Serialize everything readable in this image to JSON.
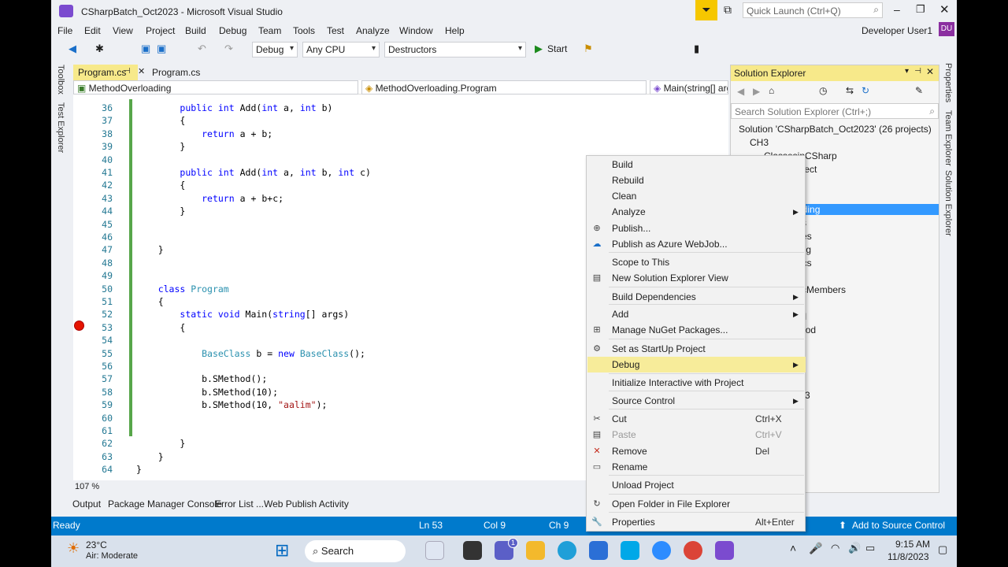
{
  "window": {
    "title": "CSharpBatch_Oct2023 - Microsoft Visual Studio",
    "quick_launch": "Quick Launch (Ctrl+Q)",
    "user": "Developer User1",
    "avatar": "DU"
  },
  "menu": [
    "File",
    "Edit",
    "View",
    "Project",
    "Build",
    "Debug",
    "Team",
    "Tools",
    "Test",
    "Analyze",
    "Window",
    "Help"
  ],
  "toolbar": {
    "config": "Debug",
    "platform": "Any CPU",
    "project": "Destructors",
    "start": "Start"
  },
  "sidebar_left": [
    "Toolbox",
    "Test Explorer"
  ],
  "tabs": [
    "Program.cs",
    "Program.cs"
  ],
  "nav": {
    "left": "MethodOverloading",
    "middle": "MethodOverloading.Program",
    "right": "Main(string[] args)"
  },
  "code": [
    {
      "n": "36",
      "t": "        public int Add(int a, int b)"
    },
    {
      "n": "37",
      "t": "        {"
    },
    {
      "n": "38",
      "t": "            return a + b;"
    },
    {
      "n": "39",
      "t": "        }"
    },
    {
      "n": "40",
      "t": ""
    },
    {
      "n": "41",
      "t": "        public int Add(int a, int b, int c)"
    },
    {
      "n": "42",
      "t": "        {"
    },
    {
      "n": "43",
      "t": "            return a + b+c;"
    },
    {
      "n": "44",
      "t": "        }"
    },
    {
      "n": "45",
      "t": ""
    },
    {
      "n": "46",
      "t": ""
    },
    {
      "n": "47",
      "t": "    }"
    },
    {
      "n": "48",
      "t": ""
    },
    {
      "n": "49",
      "t": ""
    },
    {
      "n": "50",
      "t": "    class Program"
    },
    {
      "n": "51",
      "t": "    {"
    },
    {
      "n": "52",
      "t": "        static void Main(string[] args)"
    },
    {
      "n": "53",
      "t": "        {"
    },
    {
      "n": "54",
      "t": ""
    },
    {
      "n": "55",
      "t": "            BaseClass b = new BaseClass();"
    },
    {
      "n": "56",
      "t": ""
    },
    {
      "n": "57",
      "t": "            b.SMethod();"
    },
    {
      "n": "58",
      "t": "            b.SMethod(10);"
    },
    {
      "n": "59",
      "t": "            b.SMethod(10, \"aalim\");"
    },
    {
      "n": "60",
      "t": ""
    },
    {
      "n": "61",
      "t": ""
    },
    {
      "n": "62",
      "t": "        }"
    },
    {
      "n": "63",
      "t": "    }"
    },
    {
      "n": "64",
      "t": "}"
    }
  ],
  "zoom": "107 %",
  "bottom_tabs": [
    "Output",
    "Package Manager Console",
    "Error List ...",
    "Web Publish Activity"
  ],
  "status": {
    "ready": "Ready",
    "ln": "Ln 53",
    "col": "Col 9",
    "ch": "Ch 9",
    "source_control": "Add to Source Control"
  },
  "solution_explorer": {
    "title": "Solution Explorer",
    "search": "Search Solution Explorer (Ctrl+;)",
    "items": [
      "Solution 'CSharpBatch_Oct2023' (26 projects)",
      "CH3",
      "ClassesinCSharp",
      "thMultObject",
      "uctorss",
      "uctors",
      "dOverloading",
      "perties",
      "erences",
      "p.config",
      "gram.cs",
      "ds",
      "AndPublicMembers",
      "ies",
      "iesControl",
      "TypeMethod",
      "asses",
      "ethod",
      "ariables",
      "h_Oct2023"
    ]
  },
  "sidebar_right": [
    "Properties",
    "Team Explorer",
    "Solution Explorer"
  ],
  "context_menu": [
    {
      "label": "Build"
    },
    {
      "label": "Rebuild"
    },
    {
      "label": "Clean"
    },
    {
      "label": "Analyze",
      "sub": true
    },
    {
      "label": "Publish..."
    },
    {
      "label": "Publish as Azure WebJob..."
    },
    {
      "label": "Scope to This"
    },
    {
      "label": "New Solution Explorer View"
    },
    {
      "label": "Build Dependencies",
      "sub": true
    },
    {
      "label": "Add",
      "sub": true
    },
    {
      "label": "Manage NuGet Packages..."
    },
    {
      "label": "Set as StartUp Project"
    },
    {
      "label": "Debug",
      "sub": true
    },
    {
      "label": "Initialize Interactive with Project"
    },
    {
      "label": "Source Control",
      "sub": true
    },
    {
      "label": "Cut",
      "sc": "Ctrl+X"
    },
    {
      "label": "Paste",
      "sc": "Ctrl+V"
    },
    {
      "label": "Remove",
      "sc": "Del"
    },
    {
      "label": "Rename"
    },
    {
      "label": "Unload Project"
    },
    {
      "label": "Open Folder in File Explorer"
    },
    {
      "label": "Properties",
      "sc": "Alt+Enter"
    }
  ],
  "taskbar": {
    "temp": "23°C",
    "weather": "Air: Moderate",
    "search": "Search",
    "time": "9:15 AM",
    "date": "11/8/2023",
    "badge": "1"
  }
}
